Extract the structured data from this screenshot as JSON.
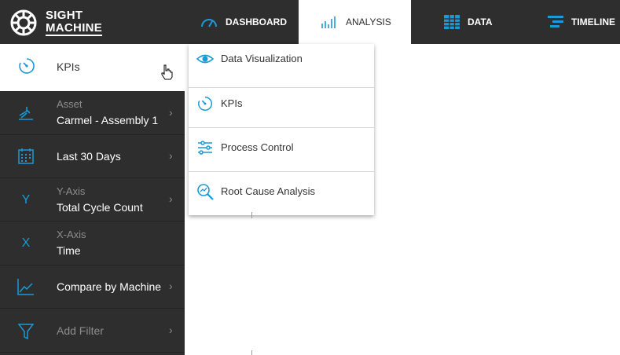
{
  "brand": {
    "line1": "SIGHT",
    "line2": "MACHINE"
  },
  "nav": {
    "dashboard": "DASHBOARD",
    "analysis": "ANALYSIS",
    "data": "DATA",
    "timeline": "TIMELINE"
  },
  "sidebar": {
    "kpis": "KPIs",
    "asset_label": "Asset",
    "asset_value": "Carmel - Assembly 1",
    "date_range": "Last 30 Days",
    "yaxis_label": "Y-Axis",
    "yaxis_value": "Total Cycle Count",
    "xaxis_label": "X-Axis",
    "xaxis_value": "Time",
    "compare": "Compare by Machine",
    "add_filter": "Add Filter"
  },
  "dropdown": {
    "items": [
      {
        "label": "Data Visualization",
        "icon": "eye-icon"
      },
      {
        "label": "KPIs",
        "icon": "gauge-icon"
      },
      {
        "label": "Process Control",
        "icon": "sliders-icon"
      },
      {
        "label": "Root Cause Analysis",
        "icon": "search-chart-icon"
      }
    ]
  },
  "colors": {
    "accent": "#1a9ad6",
    "dark": "#2e2e2e"
  }
}
